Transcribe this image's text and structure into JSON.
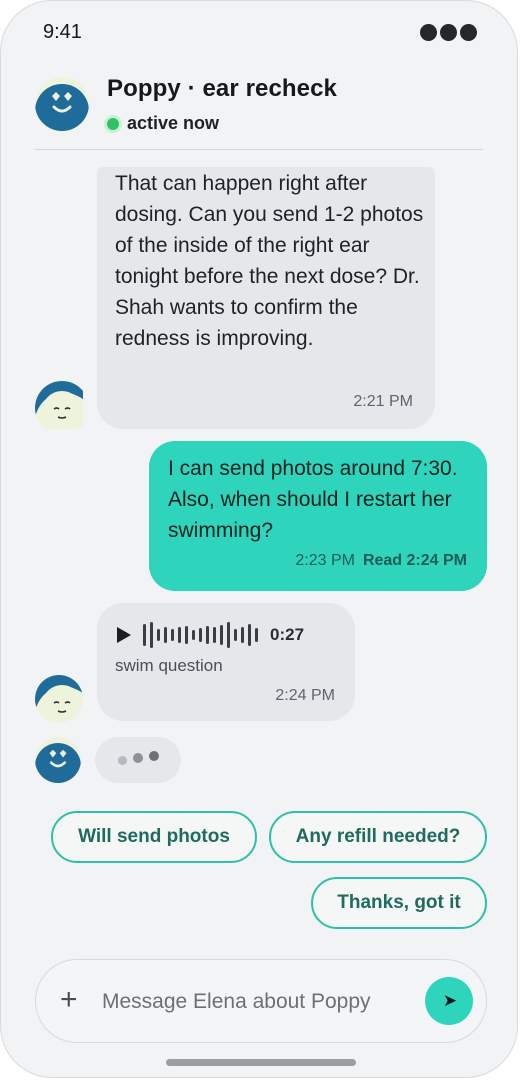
{
  "status_bar": {
    "time": "9:41"
  },
  "header": {
    "title": "Poppy · ear recheck",
    "presence": "active now"
  },
  "messages": [
    {
      "direction": "incoming",
      "text": "That can happen right after dosing. Can you send 1-2 photos of the inside of the right ear tonight before the next dose? Dr. Shah wants to confirm the redness is improving.",
      "time": "2:21 PM"
    },
    {
      "direction": "outgoing",
      "text": "I can send photos around 7:30. Also, when should I restart her swimming?",
      "time": "2:23 PM",
      "read_receipt": "Read 2:24 PM"
    },
    {
      "direction": "incoming",
      "type": "voice",
      "duration": "0:27",
      "caption": "swim question",
      "time": "2:24 PM"
    }
  ],
  "typing_indicator": {
    "visible": true
  },
  "quick_replies": [
    "Will send photos",
    "Any refill needed?",
    "Thanks, got it"
  ],
  "composer": {
    "placeholder": "Message Elena about Poppy",
    "value": ""
  },
  "icons": {
    "status": "signal-dots-icon",
    "play": "play-icon",
    "add": "plus-icon",
    "send": "send-arrow-icon"
  },
  "colors": {
    "accent": "#2fd4bd",
    "accent_border": "#2fbfa9",
    "avatar_blue": "#1f6b99",
    "avatar_cream": "#eef3dc",
    "online": "#2ec264",
    "bubble_incoming": "#e6e7eb"
  }
}
